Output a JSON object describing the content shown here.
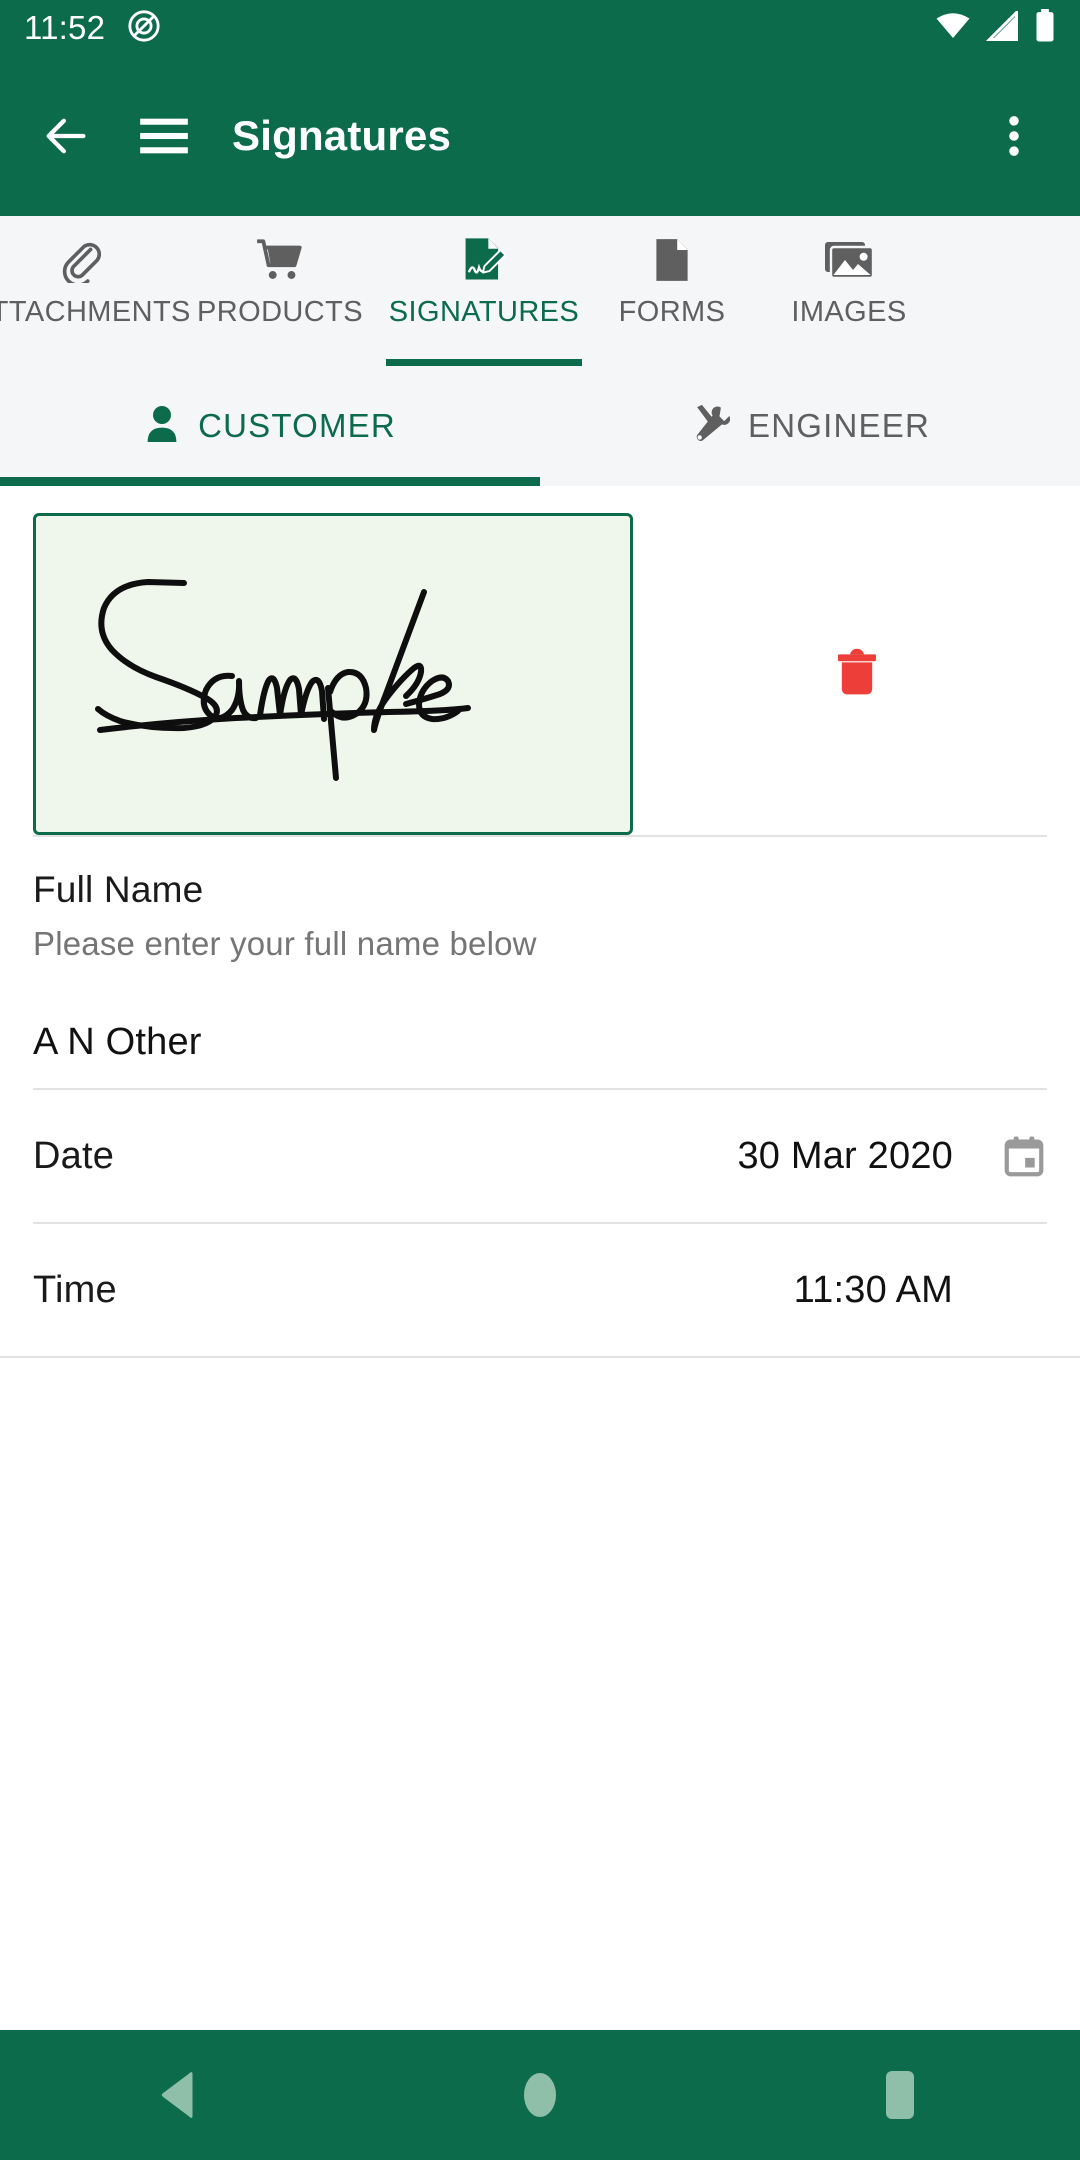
{
  "status_bar": {
    "time": "11:52",
    "icons": [
      "screenshot-capture-icon",
      "wifi-icon",
      "cellular-signal-icon",
      "battery-icon"
    ]
  },
  "app_bar": {
    "back_icon": "back-arrow-icon",
    "menu_icon": "hamburger-menu-icon",
    "title": "Signatures",
    "overflow_icon": "more-vertical-icon"
  },
  "tabs": [
    {
      "label": "ATTACHMENTS",
      "icon": "paperclip-icon",
      "active": false
    },
    {
      "label": "PRODUCTS",
      "icon": "shopping-cart-icon",
      "active": false
    },
    {
      "label": "SIGNATURES",
      "icon": "signature-document-icon",
      "active": true
    },
    {
      "label": "FORMS",
      "icon": "document-icon",
      "active": false
    },
    {
      "label": "IMAGES",
      "icon": "images-icon",
      "active": false
    }
  ],
  "subtabs": [
    {
      "label": "CUSTOMER",
      "icon": "person-icon",
      "active": true
    },
    {
      "label": "ENGINEER",
      "icon": "tools-icon",
      "active": false
    }
  ],
  "signature": {
    "alt": "Sample",
    "delete_icon": "trash-icon"
  },
  "full_name": {
    "title": "Full Name",
    "hint": "Please enter your full name below",
    "value": "A N Other"
  },
  "date": {
    "label": "Date",
    "value": "30 Mar 2020",
    "icon": "calendar-icon"
  },
  "time": {
    "label": "Time",
    "value": "11:30 AM"
  },
  "nav_bar": {
    "back": "nav-back-icon",
    "home": "nav-home-icon",
    "recents": "nav-recents-icon"
  },
  "colors": {
    "primary": "#0C6B4B",
    "tab_bg": "#F4F6F8",
    "signature_fill": "#EFF6EC",
    "delete_red": "#EE3E3A",
    "nav_icon": "#8FBFA8"
  }
}
